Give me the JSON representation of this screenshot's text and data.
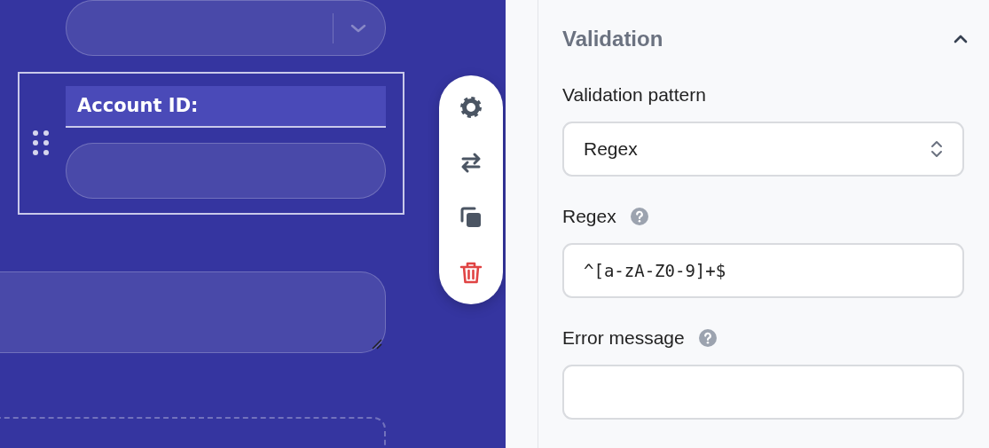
{
  "canvas": {
    "fields": [
      {
        "kind": "select",
        "selected": false
      },
      {
        "kind": "text",
        "label": "Account ID:",
        "selected": true
      },
      {
        "kind": "textarea",
        "selected": false
      },
      {
        "kind": "dropzone",
        "selected": false
      }
    ]
  },
  "toolbar": {
    "buttons": [
      {
        "kind": "settings"
      },
      {
        "kind": "swap"
      },
      {
        "kind": "duplicate"
      },
      {
        "kind": "delete"
      }
    ]
  },
  "panel": {
    "section": {
      "title": "Validation",
      "expanded": true,
      "fields": [
        {
          "kind": "select",
          "label": "Validation pattern",
          "value": "Regex"
        },
        {
          "kind": "input",
          "label": "Regex",
          "value": "^[a-zA-Z0-9]+$",
          "help": true
        },
        {
          "kind": "input",
          "label": "Error message",
          "help": true
        }
      ]
    }
  }
}
